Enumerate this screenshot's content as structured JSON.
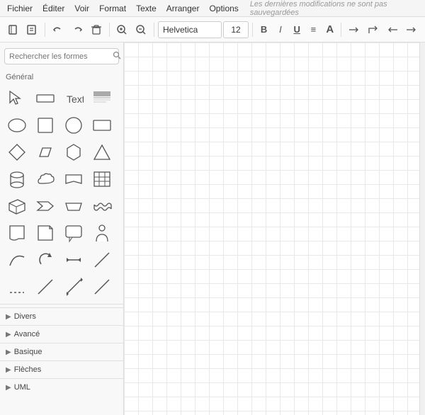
{
  "menubar": {
    "items": [
      "Fichier",
      "Éditer",
      "Voir",
      "Format",
      "Texte",
      "Arranger",
      "Options"
    ],
    "status": "Les dernières modifications ne sont pas sauvegardées"
  },
  "toolbar": {
    "font": "Helvetica",
    "font_size": "12",
    "bold_label": "B",
    "italic_label": "I",
    "underline_label": "U",
    "align_label": "≡",
    "text_label": "A"
  },
  "sidebar": {
    "search_placeholder": "Rechercher les formes",
    "general_label": "Général",
    "categories": [
      "Divers",
      "Avancé",
      "Basique",
      "Flèches",
      "UML"
    ]
  },
  "shapes": {
    "general": [
      "pointer",
      "rectangle-wide",
      "text",
      "heading",
      "ellipse",
      "square",
      "circle",
      "rect-wide2",
      "diamond",
      "parallelogram",
      "hexagon",
      "triangle",
      "cylinder",
      "cloud",
      "banner",
      "table",
      "box3d",
      "chevron",
      "trapezoid",
      "wave",
      "document",
      "folded",
      "callout",
      "person",
      "curve",
      "rotate-arrow",
      "arrow-both",
      "line",
      "line-diagonal",
      "line-h",
      "line-v",
      "line-angled"
    ]
  }
}
